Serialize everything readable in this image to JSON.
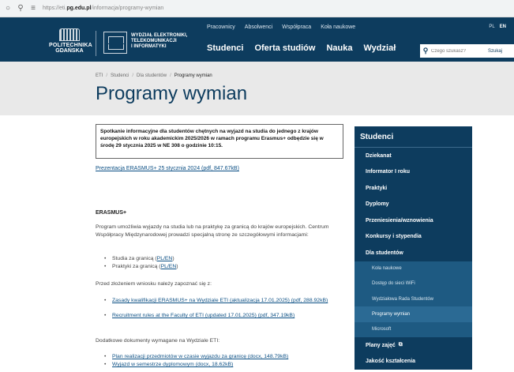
{
  "browser": {
    "url_prefix": "https://eti.",
    "url_domain": "pg.edu.pl",
    "url_path": "/informacja/programy-wymian"
  },
  "header": {
    "logo_pg_line1": "POLITECHNIKA",
    "logo_pg_line2": "GDAŃSKA",
    "logo_eti_line1": "WYDZIAŁ ELEKTRONIKI,",
    "logo_eti_line2": "TELEKOMUNIKACJI",
    "logo_eti_line3": "I INFORMATYKI",
    "topnav": [
      "Pracownicy",
      "Absolwenci",
      "Współpraca",
      "Koła naukowe"
    ],
    "lang": [
      "PL",
      "EN"
    ],
    "mainnav": [
      "Studenci",
      "Oferta studiów",
      "Nauka",
      "Wydział"
    ],
    "search_placeholder": "Czego szukasz?",
    "search_button": "Szukaj"
  },
  "breadcrumb": [
    "ETI",
    "Studenci",
    "Dla studentów",
    "Programy wymian"
  ],
  "page_title": "Programy wymian",
  "notice": "Spotkanie informacyjne dla studentów chętnych na wyjazd na studia do jednego z krajów europejskich w roku akademickim 2025/2026 w ramach programu Erasmus+ odbędzie się w środę 29 stycznia 2025 w NE 308 o godzinie 10:15.",
  "erasmus_presentation_link": "Prezentacja ERASMUS+ 25 stycznia 2024 (pdf, 847.67kB)",
  "section_heading": "ERASMUS+",
  "intro_paragraph": "Program umożliwia wyjazdy na studia lub na praktykę za granicą do krajów europejskich. Centrum Współpracy Międzynarodowej prowadzi specjalną stronę ze szczegółowymi informacjami:",
  "info_list": {
    "item1_text": "Studia za granicą (",
    "item1_link": "PL/EN",
    "item1_end": ")",
    "item2_text": "Praktyki za granicą (",
    "item2_link": "PL/EN",
    "item2_end": ")"
  },
  "before_apply_text": "Przed złożeniem wniosku należy zapoznać się z:",
  "docs_links": [
    "Zasady kwalifikacji ERASMUS+ na Wydziale ETI (aktualizacja 17.01.2025) (pdf, 288.92kB)",
    "Recruitment rules at the Faculty of ETI (updated 17.01.2025) (pdf, 347.19kB)"
  ],
  "additional_docs_text": "Dodatkowe dokumenty wymagane na Wydziale ETI:",
  "additional_links": [
    "Plan realizacji przedmiotów w czasie wyjazdu za granicę (docx, 148.79kB)",
    "Wyjazd w semestrze dyplomowym (docx, 18.62kB)"
  ],
  "sidebar": {
    "title": "Studenci",
    "items": [
      "Dziekanat",
      "Informator I roku",
      "Praktyki",
      "Dyplomy",
      "Przeniesienia/wznowienia",
      "Konkursy i stypendia",
      "Dla studentów"
    ],
    "subitems": [
      "Koła naukowe",
      "Dostęp do sieci WiFi",
      "Wydziałowa Rada Studentów",
      "Programy wymian",
      "Microsoft"
    ],
    "after_items": [
      "Plany zajęć",
      "Jakość kształcenia"
    ]
  },
  "colors": {
    "brand_navy": "#0d3c5e",
    "link_blue": "#0b4f84",
    "title_band": "#e9e9e9"
  }
}
